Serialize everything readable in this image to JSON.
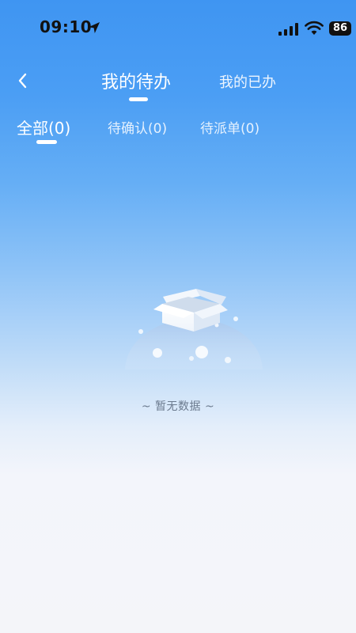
{
  "status_bar": {
    "time": "09:10",
    "battery": "86"
  },
  "header": {
    "tabs": [
      {
        "label": "我的待办",
        "active": true
      },
      {
        "label": "我的已办",
        "active": false
      }
    ]
  },
  "sub_tabs": [
    {
      "label": "全部(0)",
      "active": true
    },
    {
      "label": "待确认(0)",
      "active": false
    },
    {
      "label": "待派单(0)",
      "active": false
    }
  ],
  "empty_state": {
    "text": "~ 暂无数据 ~"
  },
  "colors": {
    "gradient_top": "#3f95f2",
    "gradient_bottom": "#f4f5f9",
    "empty_text": "#6b7a8e"
  },
  "icons": {
    "back": "chevron-left-icon",
    "location": "location-arrow-icon",
    "signal": "cellular-signal-icon",
    "wifi": "wifi-icon"
  }
}
